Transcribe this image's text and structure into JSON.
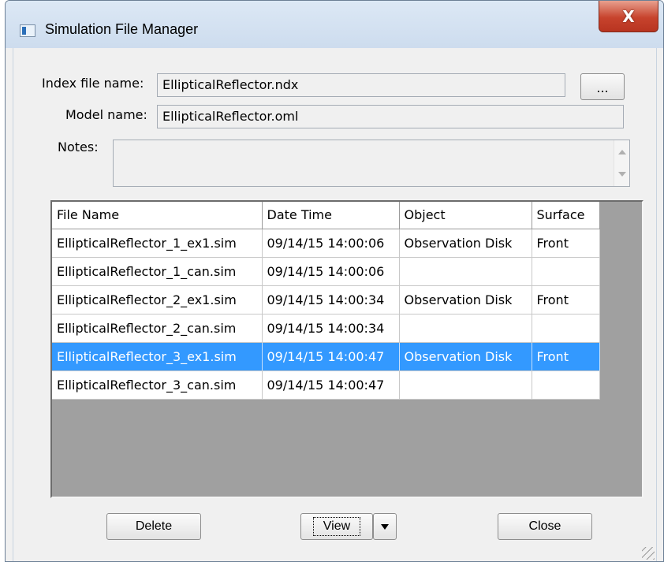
{
  "window": {
    "title": "Simulation File Manager",
    "close_glyph": "X"
  },
  "form": {
    "index_label": "Index file name:",
    "index_value": "EllipticalReflector.ndx",
    "browse_label": "...",
    "model_label": "Model name:",
    "model_value": "EllipticalReflector.oml",
    "notes_label": "Notes:",
    "notes_value": ""
  },
  "table": {
    "columns": [
      "File Name",
      "Date Time",
      "Object",
      "Surface"
    ],
    "selected_row_index": 4,
    "rows": [
      [
        "EllipticalReflector_1_ex1.sim",
        "09/14/15 14:00:06",
        "Observation Disk",
        "Front"
      ],
      [
        "EllipticalReflector_1_can.sim",
        "09/14/15 14:00:06",
        "",
        ""
      ],
      [
        "EllipticalReflector_2_ex1.sim",
        "09/14/15 14:00:34",
        "Observation Disk",
        "Front"
      ],
      [
        "EllipticalReflector_2_can.sim",
        "09/14/15 14:00:34",
        "",
        ""
      ],
      [
        "EllipticalReflector_3_ex1.sim",
        "09/14/15 14:00:47",
        "Observation Disk",
        "Front"
      ],
      [
        "EllipticalReflector_3_can.sim",
        "09/14/15 14:00:47",
        "",
        ""
      ]
    ]
  },
  "buttons": {
    "delete": "Delete",
    "view": "View",
    "close": "Close"
  },
  "icons": {
    "app": "window-icon",
    "dropdown": "chevron-down-icon",
    "scroll_up": "arrow-up-icon",
    "scroll_down": "arrow-down-icon",
    "grip": "resize-grip-icon"
  },
  "colors": {
    "selection": "#3399ff",
    "close_button": "#c7432d",
    "list_background": "#a0a0a0"
  }
}
